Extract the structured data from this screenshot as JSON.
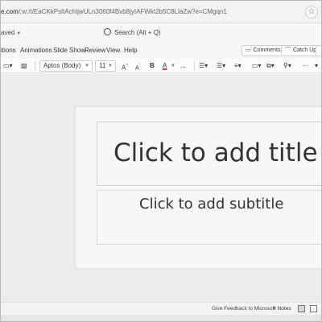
{
  "browser": {
    "url_host": "e.com",
    "url_path": "/:w:/t/EaCKkPslIAchIjwULn3060f4Bvb8jyIAFWkt2b5C8LlaZw?e=CMgqn1",
    "favorite_icon": "star-icon"
  },
  "titlebar": {
    "save_status": "aved",
    "search_placeholder": "Search (Alt + Q)"
  },
  "ribbon_tabs": [
    "itions",
    "Animations",
    "Slide Show",
    "Review",
    "View",
    "Help"
  ],
  "ribbon_buttons": {
    "comments": "Comments",
    "catchup": "Catch Up"
  },
  "toolbar": {
    "font_name": "Aptos (Body)",
    "font_size": "11",
    "grow_font": "A",
    "shrink_font": "A",
    "bold": "B",
    "font_color": "A",
    "font_color_value": "#d13438",
    "more": "..."
  },
  "slide": {
    "title_placeholder": "Click to add title",
    "subtitle_placeholder": "Click to add subtitle"
  },
  "statusbar": {
    "feedback": "Give Feedback to Microsoft",
    "notes": "Notes"
  }
}
